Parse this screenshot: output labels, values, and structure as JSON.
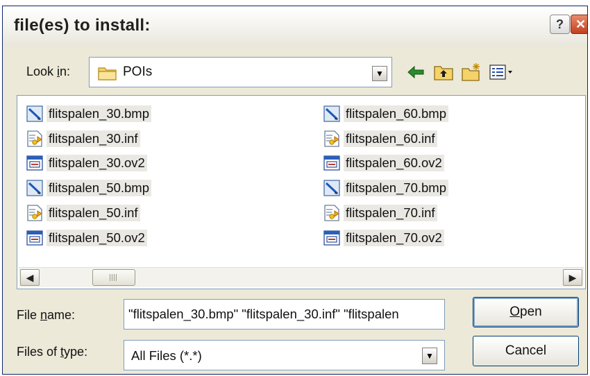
{
  "window": {
    "title": "file(es) to install:",
    "help_label": "?",
    "close_label": "✕"
  },
  "look_in": {
    "label_pre": "Look ",
    "label_key": "i",
    "label_post": "n:",
    "value": "POIs",
    "icon": "folder-icon"
  },
  "toolbar": {
    "icons": [
      "back-arrow-icon",
      "up-folder-icon",
      "new-folder-icon",
      "view-menu-icon"
    ]
  },
  "files": {
    "left": [
      {
        "name": "flitspalen_30.bmp",
        "icon": "bitmap-file-icon"
      },
      {
        "name": "flitspalen_30.inf",
        "icon": "setup-info-file-icon"
      },
      {
        "name": "flitspalen_30.ov2",
        "icon": "ov2-file-icon"
      },
      {
        "name": "flitspalen_50.bmp",
        "icon": "bitmap-file-icon"
      },
      {
        "name": "flitspalen_50.inf",
        "icon": "setup-info-file-icon"
      },
      {
        "name": "flitspalen_50.ov2",
        "icon": "ov2-file-icon"
      }
    ],
    "right": [
      {
        "name": "flitspalen_60.bmp",
        "icon": "bitmap-file-icon"
      },
      {
        "name": "flitspalen_60.inf",
        "icon": "setup-info-file-icon"
      },
      {
        "name": "flitspalen_60.ov2",
        "icon": "ov2-file-icon"
      },
      {
        "name": "flitspalen_70.bmp",
        "icon": "bitmap-file-icon"
      },
      {
        "name": "flitspalen_70.inf",
        "icon": "setup-info-file-icon"
      },
      {
        "name": "flitspalen_70.ov2",
        "icon": "ov2-file-icon"
      }
    ]
  },
  "scrollbar": {
    "left_arrow": "◀",
    "right_arrow": "▶"
  },
  "file_name": {
    "label_pre": "File ",
    "label_key": "n",
    "label_post": "ame:",
    "value": "\"flitspalen_30.bmp\" \"flitspalen_30.inf\" \"flitspalen"
  },
  "file_type": {
    "label_pre": "Files of ",
    "label_key": "t",
    "label_post": "ype:",
    "value": "All Files (*.*)"
  },
  "buttons": {
    "open_key": "O",
    "open_rest": "pen",
    "cancel": "Cancel"
  },
  "dropdown_arrow": "▼"
}
